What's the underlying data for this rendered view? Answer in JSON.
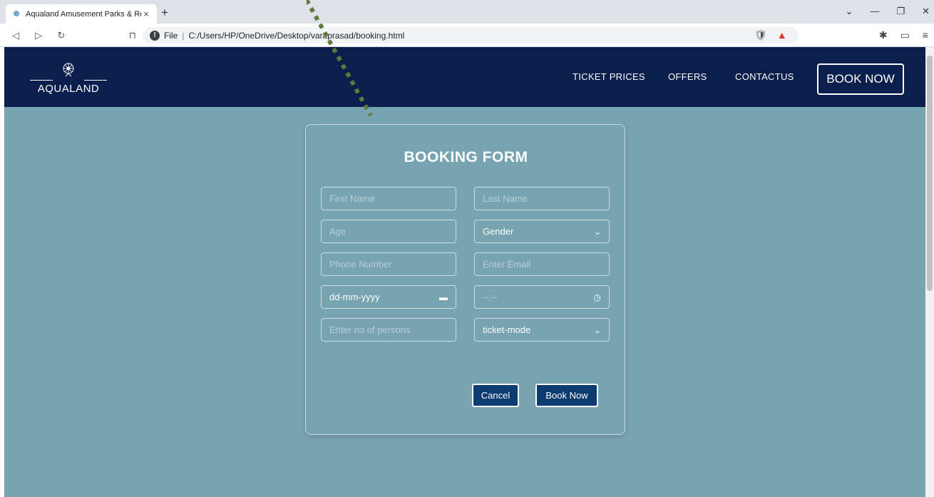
{
  "browser": {
    "tab_title": "Aqualand Amusement Parks & Re",
    "tab_close": "×",
    "new_tab": "+",
    "address_prefix": "File",
    "address_url": "C:/Users/HP/OneDrive/Desktop/varaprasad/booking.html"
  },
  "navbar": {
    "logo_text": "AQUALAND",
    "links": [
      "TICKET PRICES",
      "OFFERS",
      "CONTACTUS"
    ],
    "book_now": "BOOK NOW"
  },
  "form": {
    "title": "BOOKING FORM",
    "first_name_placeholder": "First Name",
    "last_name_placeholder": "Last Name",
    "age_placeholder": "Age",
    "gender_value": "Gender",
    "phone_placeholder": "Phone Number",
    "email_placeholder": "Enter Email",
    "date_placeholder": "dd-mm-yyyy",
    "time_placeholder": "--:--",
    "persons_placeholder": "Enter no of persons",
    "ticket_mode_value": "ticket-mode",
    "cancel_label": "Cancel",
    "book_label": "Book Now"
  },
  "colors": {
    "page_bg": "#78a3b0",
    "navbar_bg": "#0b1f4f",
    "button_bg": "#0b3b71",
    "annotation_dots": "#5e7a3a"
  },
  "icons": [
    "back-icon",
    "forward-icon",
    "reload-icon",
    "bookmark-icon",
    "info-icon",
    "brave-shield-icon",
    "brave-rewards-icon",
    "extensions-icon",
    "wallet-icon",
    "menu-icon",
    "ferris-wheel-icon",
    "chevron-down-icon",
    "calendar-icon",
    "clock-icon"
  ]
}
